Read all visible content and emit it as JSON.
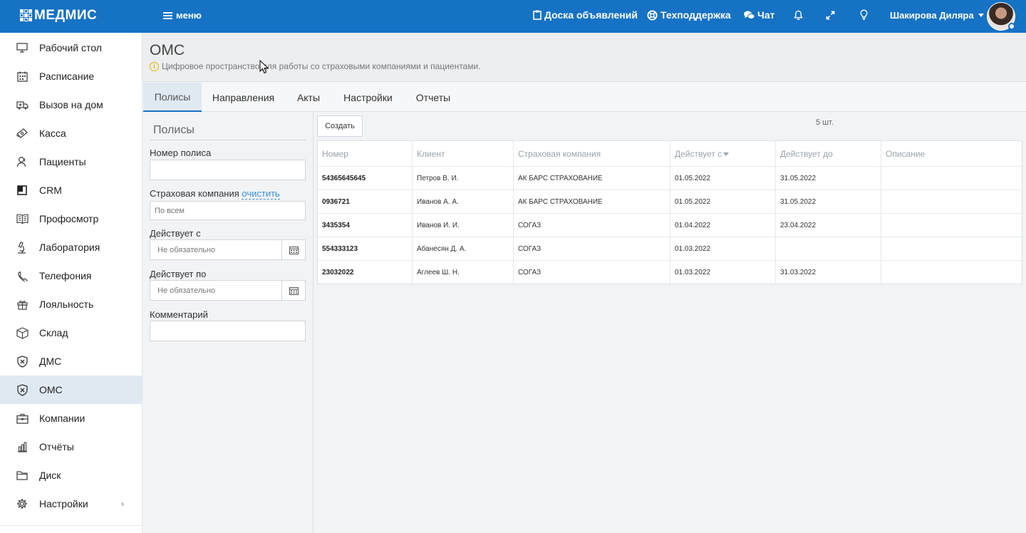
{
  "topbar": {
    "logo": "МЕДМИС",
    "menu_label": "меню",
    "board_label": "Доска объявлений",
    "support_label": "Техподдержка",
    "chat_label": "Чат",
    "user_name": "Шакирова Диляра"
  },
  "sidebar": {
    "items": [
      {
        "label": "Рабочий стол",
        "icon": "monitor-icon"
      },
      {
        "label": "Расписание",
        "icon": "calendar-icon"
      },
      {
        "label": "Вызов на дом",
        "icon": "ambulance-icon"
      },
      {
        "label": "Касса",
        "icon": "money-icon"
      },
      {
        "label": "Пациенты",
        "icon": "patients-icon"
      },
      {
        "label": "CRM",
        "icon": "crm-icon"
      },
      {
        "label": "Профосмотр",
        "icon": "book-icon"
      },
      {
        "label": "Лаборатория",
        "icon": "microscope-icon"
      },
      {
        "label": "Телефония",
        "icon": "phone-icon"
      },
      {
        "label": "Лояльность",
        "icon": "gift-icon"
      },
      {
        "label": "Склад",
        "icon": "box-icon"
      },
      {
        "label": "ДМС",
        "icon": "shield-icon"
      },
      {
        "label": "ОМС",
        "icon": "shield-icon"
      },
      {
        "label": "Компании",
        "icon": "briefcase-icon"
      },
      {
        "label": "Отчёты",
        "icon": "bar-chart-icon"
      },
      {
        "label": "Диск",
        "icon": "folder-icon"
      },
      {
        "label": "Настройки",
        "icon": "gear-icon"
      }
    ],
    "active": "ОМС"
  },
  "page": {
    "title": "ОМС",
    "subtitle": "Цифровое пространство для работы со страховыми компаниями и пациентами."
  },
  "tabs": [
    "Полисы",
    "Направления",
    "Акты",
    "Настройки",
    "Отчеты"
  ],
  "filter": {
    "title": "Полисы",
    "policy_number_label": "Номер полиса",
    "policy_number_value": "",
    "insurance_label": "Страховая компания",
    "clear_link": "очистить",
    "insurance_value": "По всем",
    "valid_from_label": "Действует с",
    "valid_from_placeholder": "Не обязательно",
    "valid_to_label": "Действует по",
    "valid_to_placeholder": "Не обязательно",
    "comment_label": "Комментарий",
    "comment_value": ""
  },
  "table": {
    "create_label": "Создать",
    "count": "5 шт.",
    "columns": [
      "Номер",
      "Клиент",
      "Страховая компания",
      "Действует с",
      "Действует до",
      "Описание"
    ],
    "rows": [
      [
        "54365645645",
        "Петров В. И.",
        "АК БАРС СТРАХОВАНИЕ",
        "01.05.2022",
        "31.05.2022",
        ""
      ],
      [
        "0936721",
        "Иванов А. А.",
        "АК БАРС СТРАХОВАНИЕ",
        "01.05.2022",
        "31.05.2022",
        ""
      ],
      [
        "3435354",
        "Иванов И. И.",
        "СОГАЗ",
        "01.04.2022",
        "23.04.2022",
        ""
      ],
      [
        "554333123",
        "Абанесян Д. А.",
        "СОГАЗ",
        "01.03.2022",
        "",
        ""
      ],
      [
        "23032022",
        "Аглеев Ш. Н.",
        "СОГАЗ",
        "01.03.2022",
        "31.03.2022",
        ""
      ]
    ]
  }
}
